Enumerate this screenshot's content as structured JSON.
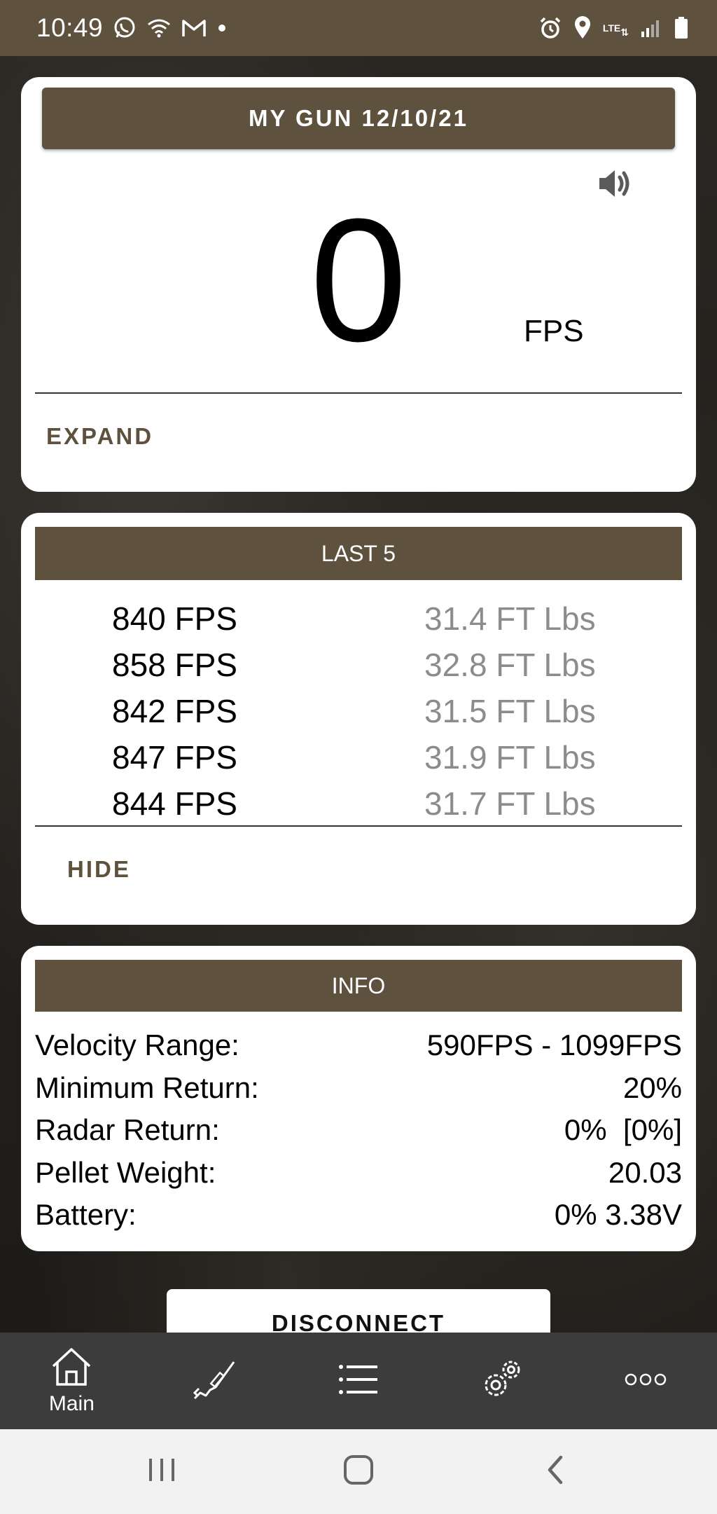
{
  "status_bar": {
    "time": "10:49",
    "network": "LTE",
    "icons": [
      "whatsapp-icon",
      "wifi-icon",
      "gmail-icon",
      "dot-icon",
      "alarm-icon",
      "location-icon",
      "signal-icon",
      "battery-icon"
    ]
  },
  "main_card": {
    "profile_name": "MY GUN 12/10/21",
    "velocity": "0",
    "unit": "FPS",
    "expand_label": "EXPAND",
    "sound_icon": "speaker-icon"
  },
  "last_card": {
    "title": "LAST 5",
    "shots": [
      {
        "fps": "840 FPS",
        "energy": "31.4 FT Lbs"
      },
      {
        "fps": "858 FPS",
        "energy": "32.8 FT Lbs"
      },
      {
        "fps": "842 FPS",
        "energy": "31.5 FT Lbs"
      },
      {
        "fps": "847 FPS",
        "energy": "31.9 FT Lbs"
      },
      {
        "fps": "844 FPS",
        "energy": "31.7 FT Lbs"
      }
    ],
    "hide_label": "HIDE"
  },
  "info_card": {
    "title": "INFO",
    "rows": [
      {
        "label": "Velocity Range:",
        "value": "590FPS - 1099FPS"
      },
      {
        "label": "Minimum Return:",
        "value": "20%"
      },
      {
        "label": "Radar Return:",
        "value": "0%  [0%]"
      },
      {
        "label": "Pellet Weight:",
        "value": "20.03"
      },
      {
        "label": "Battery:",
        "value": "0% 3.38V"
      }
    ]
  },
  "disconnect_label": "DISCONNECT",
  "bottom_nav": {
    "items": [
      {
        "icon": "home-icon",
        "label": "Main"
      },
      {
        "icon": "rifle-icon",
        "label": ""
      },
      {
        "icon": "list-icon",
        "label": ""
      },
      {
        "icon": "settings-icon",
        "label": ""
      },
      {
        "icon": "more-icon",
        "label": ""
      }
    ]
  },
  "colors": {
    "brand": "#5e513e",
    "nav_bg": "#3c3c3c",
    "secondary_text": "#8c8c8c"
  }
}
